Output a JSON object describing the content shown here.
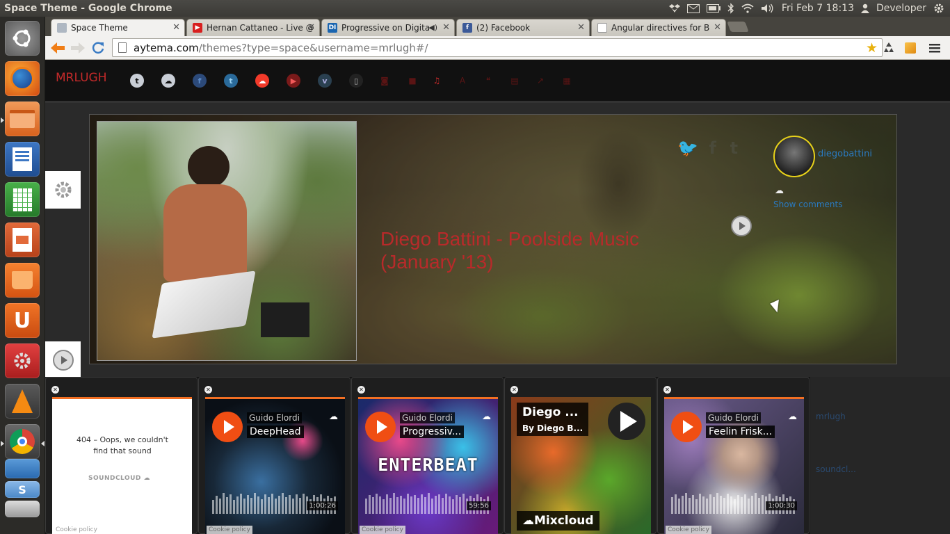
{
  "topbar": {
    "window_title": "Space Theme - Google Chrome",
    "datetime": "Fri Feb  7 18:13",
    "user": "Developer"
  },
  "tabs": [
    {
      "label": "Space Theme",
      "favicon": "page-icon",
      "active": true
    },
    {
      "label": "Hernan Cattaneo - Live @",
      "favicon": "youtube-icon"
    },
    {
      "label": "Progressive on Digitall",
      "favicon": "di-icon",
      "audio": true
    },
    {
      "label": "(2) Facebook",
      "favicon": "facebook-icon"
    },
    {
      "label": "Angular directives for Bo",
      "favicon": "page-icon"
    }
  ],
  "omnibox": {
    "host": "aytema.com",
    "path": "/themes?type=space&username=mrlugh#/"
  },
  "site": {
    "brand": "MRLUGH",
    "social_icons": [
      "tumblr-icon",
      "cloud-icon",
      "facebook-icon",
      "twitter-icon",
      "soundcloud-icon",
      "youtube-icon",
      "vimeo-icon",
      "mouse-icon",
      "camera-icon",
      "video-icon",
      "music-icon",
      "font-icon",
      "quote-icon",
      "book-icon",
      "external-link-icon",
      "calendar-icon"
    ],
    "accent_color": "#c42a2a"
  },
  "stage": {
    "track_title": "Diego Battini - Poolside Music (January '13)",
    "artist": "diegobattini",
    "show_comments": "Show comments"
  },
  "embeds": [
    {
      "type": "error",
      "message": "404 – Oops, we couldn't find that sound",
      "brand": "SOUNDCLOUD",
      "cookie": "Cookie policy"
    },
    {
      "type": "soundcloud",
      "user": "Guido Elordi",
      "title": "DeepHead",
      "duration": "1:00:26",
      "cookie": "Cookie policy"
    },
    {
      "type": "soundcloud",
      "user": "Guido Elordi",
      "title": "Progressiv...",
      "duration": "59:56",
      "cookie": "Cookie policy"
    },
    {
      "type": "mixcloud",
      "title": "Diego ...",
      "by": "By Diego B...",
      "brand": "Mixcloud"
    },
    {
      "type": "soundcloud",
      "user": "Guido Elordi",
      "title": "Feelin Frisk...",
      "duration": "1:00:30",
      "cookie": "Cookie policy"
    }
  ],
  "faded_links": [
    "mrlugh",
    "soundcl..."
  ]
}
